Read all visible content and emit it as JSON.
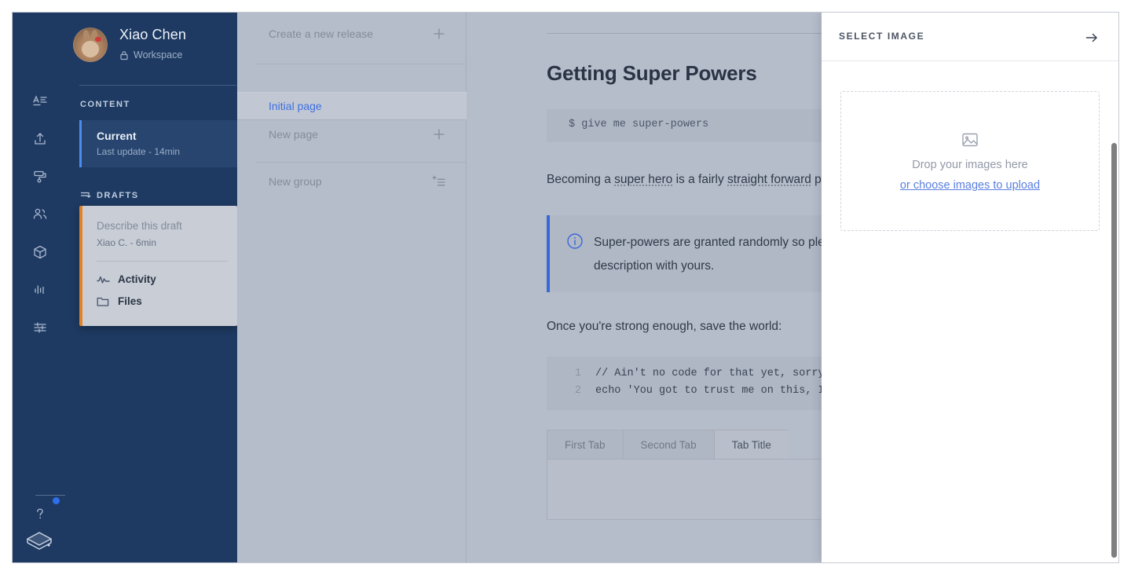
{
  "sidebar": {
    "profile": {
      "name": "Xiao Chen",
      "subtitle": "Workspace",
      "lock_icon": "lock-icon",
      "avatar_icon": "avatar-rabbit"
    },
    "collapse_icon": "arrow-left-icon",
    "rail_icons": [
      "text-format-icon",
      "upload-icon",
      "paint-roller-icon",
      "users-icon",
      "box-icon",
      "bar-chart-icon",
      "sliders-icon",
      "help-icon",
      "layers-icon"
    ],
    "content_section_label": "CONTENT",
    "current": {
      "title": "Current",
      "subtitle": "Last update - 14min"
    },
    "drafts_section_label": "DRAFTS",
    "drafts_icon": "drafts-icon",
    "draft_card": {
      "description": "Describe this draft",
      "meta": "Xiao C. - 6min",
      "links": [
        {
          "label": "Activity",
          "icon": "activity-icon"
        },
        {
          "label": "Files",
          "icon": "folder-icon"
        }
      ]
    },
    "accent_blue": "#4d8df0",
    "accent_orange": "#e38326",
    "background": "#1e3a62"
  },
  "page_panel": {
    "rows": [
      {
        "label": "Create a new release",
        "action_icon": "plus-icon",
        "active": false
      },
      {
        "label": "Initial page",
        "action_icon": "",
        "active": true
      },
      {
        "label": "New page",
        "action_icon": "plus-icon",
        "active": false
      },
      {
        "label": "New group",
        "action_icon": "add-group-icon",
        "active": false
      }
    ],
    "active_color": "#3e6fe0"
  },
  "editor": {
    "title": "Getting Super Powers",
    "shell_command": "$ give me super-powers",
    "paragraph_1": {
      "before": "Becoming a ",
      "spell_1": "super hero",
      "middle": " is a fairly ",
      "spell_2": "straight forward",
      "after": " process:"
    },
    "callout": {
      "icon": "info-circle-icon",
      "text": "Super-powers are granted randomly so please submit an unusual and interesting description with yours.",
      "accent": "#3769d8"
    },
    "paragraph_2": "Once you're strong enough, save the world:",
    "code_block": {
      "lines": [
        {
          "number": "1",
          "source": "// Ain't no code for that yet, sorry"
        },
        {
          "number": "2",
          "source": "echo 'You got to trust me on this, I saved the world'"
        }
      ]
    },
    "tabs": [
      {
        "label": "First Tab",
        "active": false
      },
      {
        "label": "Second Tab",
        "active": false
      },
      {
        "label": "Tab Title",
        "active": true
      }
    ]
  },
  "image_panel": {
    "title": "SELECT IMAGE",
    "close_icon": "arrow-right-icon",
    "dropzone": {
      "icon": "image-placeholder-icon",
      "primary_text": "Drop your images here",
      "link_text": "or choose images to upload"
    }
  }
}
